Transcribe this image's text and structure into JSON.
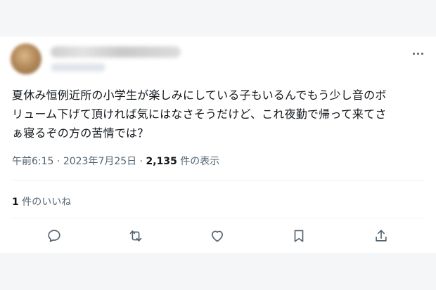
{
  "tweet": {
    "text_line1": "夏休み恒例近所の小学生が楽しみにしている子もいるんでもう少し音のボ",
    "text_line2": "リューム下げて頂ければ気にはなさそうだけど、これ夜勤で帰って来てさ",
    "text_line3": "ぁ寝るぞの方の苦情では？",
    "time": "午前6:15",
    "separator": "·",
    "date": "2023年7月25日",
    "views_count": "2,135",
    "views_label": "件の表示",
    "likes_count": "1",
    "likes_label": "件のいいね"
  },
  "actions": {
    "reply_icon": "reply-icon",
    "retweet_icon": "retweet-icon",
    "like_icon": "heart-icon",
    "bookmark_icon": "bookmark-icon",
    "share_icon": "share-icon"
  },
  "colors": {
    "text": "#0f1419",
    "secondary": "#536471",
    "divider": "#eff3f4",
    "background_band": "#f5f6f7"
  }
}
